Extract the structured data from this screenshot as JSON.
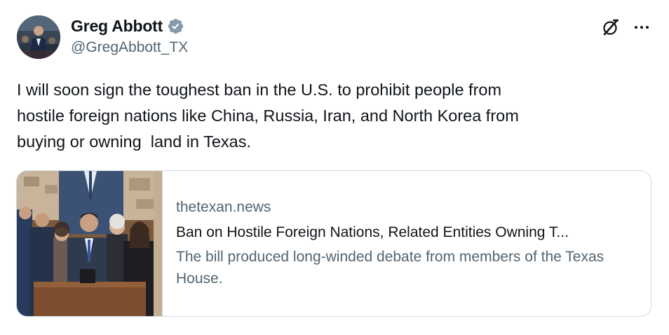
{
  "author": {
    "display_name": "Greg Abbott",
    "handle": "@GregAbbott_TX",
    "verified": true,
    "verified_badge_color": "#829aab"
  },
  "icons": {
    "avatar": "avatar-photo",
    "verified": "verified-badge-icon",
    "grok": "grok-icon",
    "more": "more-options-icon"
  },
  "tweet": {
    "text": "I will soon sign the toughest ban in the U.S. to prohibit people from\nhostile foreign nations like China, Russia, Iran, and North Korea from\nbuying or owning  land in Texas."
  },
  "link_card": {
    "domain": "thetexan.news",
    "title": "Ban on Hostile Foreign Nations, Related Entities Owning T...",
    "description": "The bill produced long-winded debate from members of the Texas House."
  },
  "colors": {
    "text_primary": "#0f1419",
    "text_secondary": "#536471",
    "border": "#cfd9de"
  }
}
